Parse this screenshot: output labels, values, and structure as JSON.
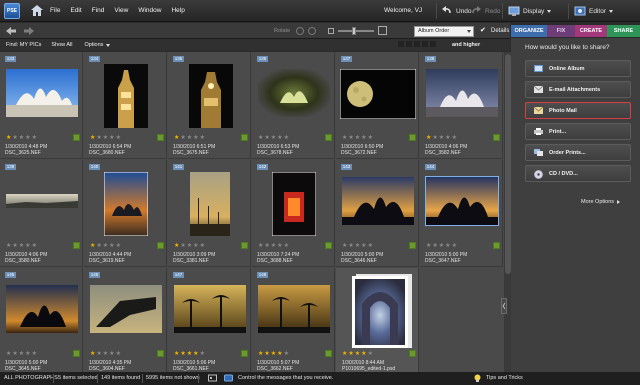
{
  "menubar": {
    "logo_text": "PSE",
    "menus": [
      "File",
      "Edit",
      "Find",
      "View",
      "Window",
      "Help"
    ],
    "welcome": "Welcome, VJ",
    "undo": "Undo",
    "redo": "Redo",
    "display": "Display",
    "editor": "Editor"
  },
  "tabs": {
    "organize": "ORGANIZE",
    "fix": "FIX",
    "create": "CREATE",
    "share": "SHARE"
  },
  "toolbar": {
    "rotate": "Rotate",
    "sort": "Album Order",
    "details": "Details"
  },
  "findbar": {
    "find": "Find: MY PICs",
    "showall": "Show All",
    "options": "Options",
    "higher": "and higher"
  },
  "photos": [
    {
      "num": "133",
      "rating": 1,
      "date": "1/30/2010 4:48 PM",
      "file": "DSC_3625.NEF"
    },
    {
      "num": "134",
      "rating": 1,
      "date": "1/30/2010 6:54 PM",
      "file": "DSC_3680.NEF"
    },
    {
      "num": "135",
      "rating": 1,
      "date": "1/30/2010 6:51 PM",
      "file": "DSC_3675.NEF"
    },
    {
      "num": "136",
      "rating": 0,
      "date": "1/30/2010 6:53 PM",
      "file": "DSC_3678.NEF"
    },
    {
      "num": "137",
      "rating": 0,
      "date": "1/30/2010 6:50 PM",
      "file": "DSC_3672.NEF"
    },
    {
      "num": "138",
      "rating": 1,
      "date": "1/30/2010 4:06 PM",
      "file": "DSC_3582.NEF"
    },
    {
      "num": "139",
      "rating": 0,
      "date": "1/30/2010 4:06 PM",
      "file": "DSC_3580.NEF"
    },
    {
      "num": "140",
      "rating": 1,
      "date": "1/30/2010 4:44 PM",
      "file": "DSC_3619.NEF"
    },
    {
      "num": "141",
      "rating": 1,
      "date": "1/30/2010 3:09 PM",
      "file": "DSC_3381.NEF"
    },
    {
      "num": "142",
      "rating": 0,
      "date": "1/30/2010 7:24 PM",
      "file": "DSC_3688.NEF"
    },
    {
      "num": "143",
      "rating": 0,
      "date": "1/30/2010 5:00 PM",
      "file": "DSC_3646.NEF"
    },
    {
      "num": "144",
      "rating": 0,
      "date": "1/30/2010 5:00 PM",
      "file": "DSC_3647.NEF"
    },
    {
      "num": "145",
      "rating": 0,
      "date": "1/30/2010 5:00 PM",
      "file": "DSC_3645.NEF"
    },
    {
      "num": "146",
      "rating": 1,
      "date": "1/30/2010 4:35 PM",
      "file": "DSC_3604.NEF"
    },
    {
      "num": "147",
      "rating": 4,
      "date": "1/30/2010 5:06 PM",
      "file": "DSC_3661.NEF"
    },
    {
      "num": "148",
      "rating": 4,
      "date": "1/30/2010 5:07 PM",
      "file": "DSC_3662.NEF"
    },
    {
      "num": "",
      "rating": 4,
      "date": "1/30/2010 8:44 AM",
      "file": "P1010695_edited-1.psd"
    }
  ],
  "panel": {
    "title": "How would you like to share?",
    "buttons": [
      "Online Album",
      "E-mail Attachments",
      "Photo Mail",
      "Print...",
      "Order Prints...",
      "CD / DVD..."
    ],
    "more": "More Options"
  },
  "status": {
    "album": "ALL PHOTOGRAPHS",
    "selected": "5 items selected",
    "found": "149 items found",
    "not_shown": "5995 items not shown",
    "message": "Control the messages that you receive.",
    "tips": "Tips and Tricks"
  }
}
